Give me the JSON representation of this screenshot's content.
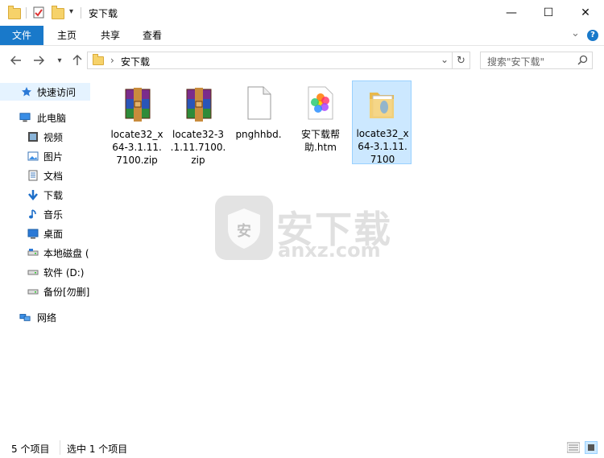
{
  "window": {
    "title": "安下载",
    "controls": {
      "minimize": "—",
      "maximize": "☐",
      "close": "✕"
    }
  },
  "ribbon": {
    "tabs": [
      "文件",
      "主页",
      "共享",
      "查看"
    ],
    "expand_icon": "⌄",
    "help_icon": "?"
  },
  "address": {
    "path": "安下载",
    "separator": "›",
    "search_placeholder": "搜索\"安下载\""
  },
  "nav": {
    "quick_access": "快速访问",
    "this_pc": "此电脑",
    "items": [
      {
        "label": "视频",
        "icon": "video-icon"
      },
      {
        "label": "图片",
        "icon": "pictures-icon"
      },
      {
        "label": "文档",
        "icon": "documents-icon"
      },
      {
        "label": "下载",
        "icon": "downloads-icon"
      },
      {
        "label": "音乐",
        "icon": "music-icon"
      },
      {
        "label": "桌面",
        "icon": "desktop-icon"
      },
      {
        "label": "本地磁盘 (",
        "icon": "drive-icon"
      },
      {
        "label": "软件 (D:)",
        "icon": "drive-icon"
      },
      {
        "label": "备份[勿删]",
        "icon": "drive-icon"
      }
    ],
    "network": "网络"
  },
  "files": [
    {
      "name": "locate32_x64-3.1.11.7100.zip",
      "lines": [
        "locate32_x",
        "64-3.1.11.",
        "7100.zip"
      ],
      "icon": "winrar-archive-icon",
      "selected": false
    },
    {
      "name": "locate32-3.1.11.7100.zip",
      "lines": [
        "locate32-3",
        ".1.11.7100.",
        "zip"
      ],
      "icon": "winrar-archive-icon",
      "selected": false
    },
    {
      "name": "pnghhbd.",
      "lines": [
        "pnghhbd."
      ],
      "icon": "blank-file-icon",
      "selected": false
    },
    {
      "name": "安下载帮助.htm",
      "lines": [
        "安下载帮",
        "助.htm"
      ],
      "icon": "photos-htm-icon",
      "selected": false
    },
    {
      "name": "locate32_x64-3.1.11.7100",
      "lines": [
        "locate32_x",
        "64-3.1.11.",
        "7100"
      ],
      "icon": "folder-icon",
      "selected": true
    }
  ],
  "watermark": {
    "text_cn": "安下载",
    "text_en": "anxz.com",
    "shield_char": "安"
  },
  "status": {
    "count": "5 个项目",
    "selection": "选中 1 个项目"
  },
  "colors": {
    "accent": "#1979ca",
    "selection_bg": "#cce8ff",
    "selection_border": "#99d1ff"
  }
}
